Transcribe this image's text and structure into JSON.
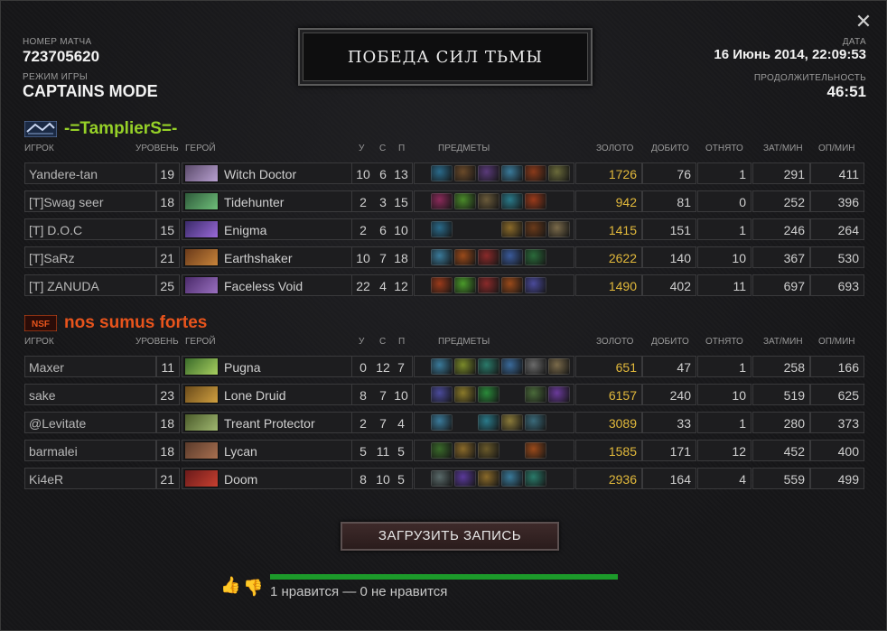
{
  "match": {
    "number_label": "НОМЕР МАТЧА",
    "number": "723705620",
    "mode_label": "РЕЖИМ ИГРЫ",
    "mode": "CAPTAINS MODE",
    "date_label": "ДАТА",
    "date": "16 Июнь 2014, 22:09:53",
    "duration_label": "ПРОДОЛЖИТЕЛЬНОСТЬ",
    "duration": "46:51",
    "result": "ПОБЕДА СИЛ ТЬМЫ"
  },
  "columns": {
    "player": "ИГРОК",
    "level": "УРОВЕНЬ",
    "hero": "ГЕРОЙ",
    "k": "У",
    "d": "С",
    "a": "П",
    "items": "ПРЕДМЕТЫ",
    "gold": "ЗОЛОТО",
    "lh": "ДОБИТО",
    "dn": "ОТНЯТО",
    "xpm": "ЗАТ/МИН",
    "gpm": "ОП/МИН"
  },
  "colors": {
    "radiant": "#96d128",
    "dire": "#e8541c",
    "gold": "#e2b93b",
    "like_bar": "#1c9a2a"
  },
  "teams": [
    {
      "name": "-=TamplierS=-",
      "players": [
        {
          "player": "Yandere-tan",
          "level": "19",
          "hero": "Witch Doctor",
          "k": "10",
          "d": "6",
          "a": "13",
          "gold": "1726",
          "lh": "76",
          "dn": "1",
          "xpm": "291",
          "gpm": "411"
        },
        {
          "player": "[T]Swag seer",
          "level": "18",
          "hero": "Tidehunter",
          "k": "2",
          "d": "3",
          "a": "15",
          "gold": "942",
          "lh": "81",
          "dn": "0",
          "xpm": "252",
          "gpm": "396"
        },
        {
          "player": "[T] D.O.C",
          "level": "15",
          "hero": "Enigma",
          "k": "2",
          "d": "6",
          "a": "10",
          "gold": "1415",
          "lh": "151",
          "dn": "1",
          "xpm": "246",
          "gpm": "264"
        },
        {
          "player": "[T]SaRz",
          "level": "21",
          "hero": "Earthshaker",
          "k": "10",
          "d": "7",
          "a": "18",
          "gold": "2622",
          "lh": "140",
          "dn": "10",
          "xpm": "367",
          "gpm": "530"
        },
        {
          "player": "[T]  ZANUDA",
          "level": "25",
          "hero": "Faceless Void",
          "k": "22",
          "d": "4",
          "a": "12",
          "gold": "1490",
          "lh": "402",
          "dn": "11",
          "xpm": "697",
          "gpm": "693"
        }
      ]
    },
    {
      "name": "nos sumus fortes",
      "players": [
        {
          "player": "Maxer",
          "level": "11",
          "hero": "Pugna",
          "k": "0",
          "d": "12",
          "a": "7",
          "gold": "651",
          "lh": "47",
          "dn": "1",
          "xpm": "258",
          "gpm": "166"
        },
        {
          "player": "sake",
          "level": "23",
          "hero": "Lone Druid",
          "k": "8",
          "d": "7",
          "a": "10",
          "gold": "6157",
          "lh": "240",
          "dn": "10",
          "xpm": "519",
          "gpm": "625"
        },
        {
          "player": "@Levitate",
          "level": "18",
          "hero": "Treant Protector",
          "k": "2",
          "d": "7",
          "a": "4",
          "gold": "3089",
          "lh": "33",
          "dn": "1",
          "xpm": "280",
          "gpm": "373"
        },
        {
          "player": "barmalei",
          "level": "18",
          "hero": "Lycan",
          "k": "5",
          "d": "11",
          "a": "5",
          "gold": "1585",
          "lh": "171",
          "dn": "12",
          "xpm": "452",
          "gpm": "400"
        },
        {
          "player": "Ki4eR",
          "level": "21",
          "hero": "Doom",
          "k": "8",
          "d": "10",
          "a": "5",
          "gold": "2936",
          "lh": "164",
          "dn": "4",
          "xpm": "559",
          "gpm": "499"
        }
      ]
    }
  ],
  "actions": {
    "download": "ЗАГРУЗИТЬ ЗАПИСЬ",
    "votes": "1 нравится — 0 не нравится"
  }
}
